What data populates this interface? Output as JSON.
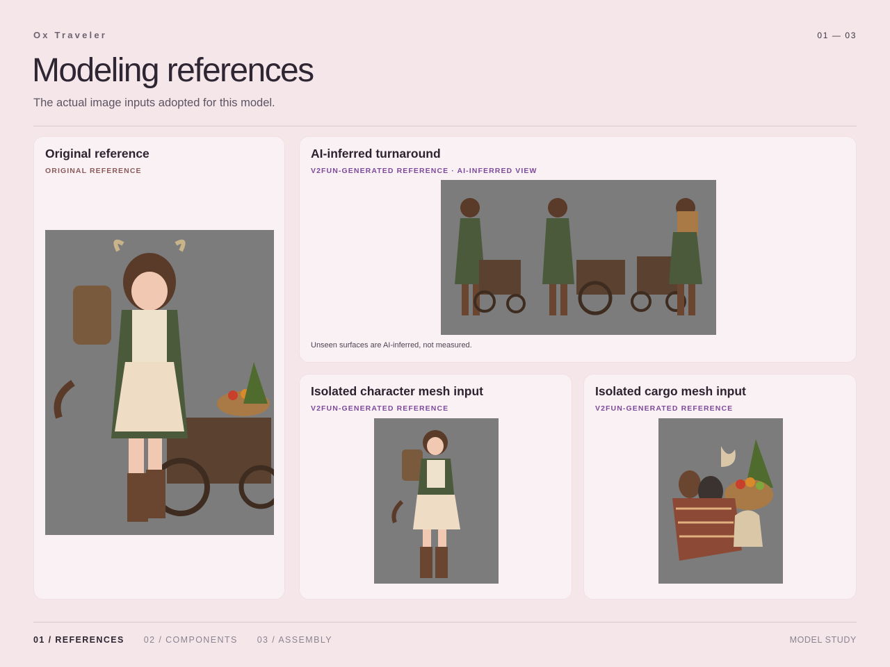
{
  "header": {
    "brand": "Ox Traveler",
    "pager": "01 — 03",
    "title": "Modeling references",
    "subtitle": "The actual image inputs adopted for this model."
  },
  "cards": {
    "original": {
      "title": "Original reference",
      "tag": "ORIGINAL REFERENCE"
    },
    "turnaround": {
      "title": "AI-inferred turnaround",
      "tag": "V2FUN-GENERATED REFERENCE · AI-INFERRED VIEW",
      "note": "Unseen surfaces are AI-inferred, not measured."
    },
    "character": {
      "title": "Isolated character mesh input",
      "tag": "V2FUN-GENERATED REFERENCE"
    },
    "cargo": {
      "title": "Isolated cargo mesh input",
      "tag": "V2FUN-GENERATED REFERENCE"
    }
  },
  "footer": {
    "nav": [
      "01 / REFERENCES",
      "02 / COMPONENTS",
      "03 / ASSEMBLY"
    ],
    "right": "MODEL STUDY"
  },
  "colors": {
    "background": "#f5e6ea",
    "card": "#faf1f4",
    "tag_brown": "#8a5a5a",
    "tag_purple": "#7d4a9a",
    "image_gray": "#7b7b7b"
  }
}
